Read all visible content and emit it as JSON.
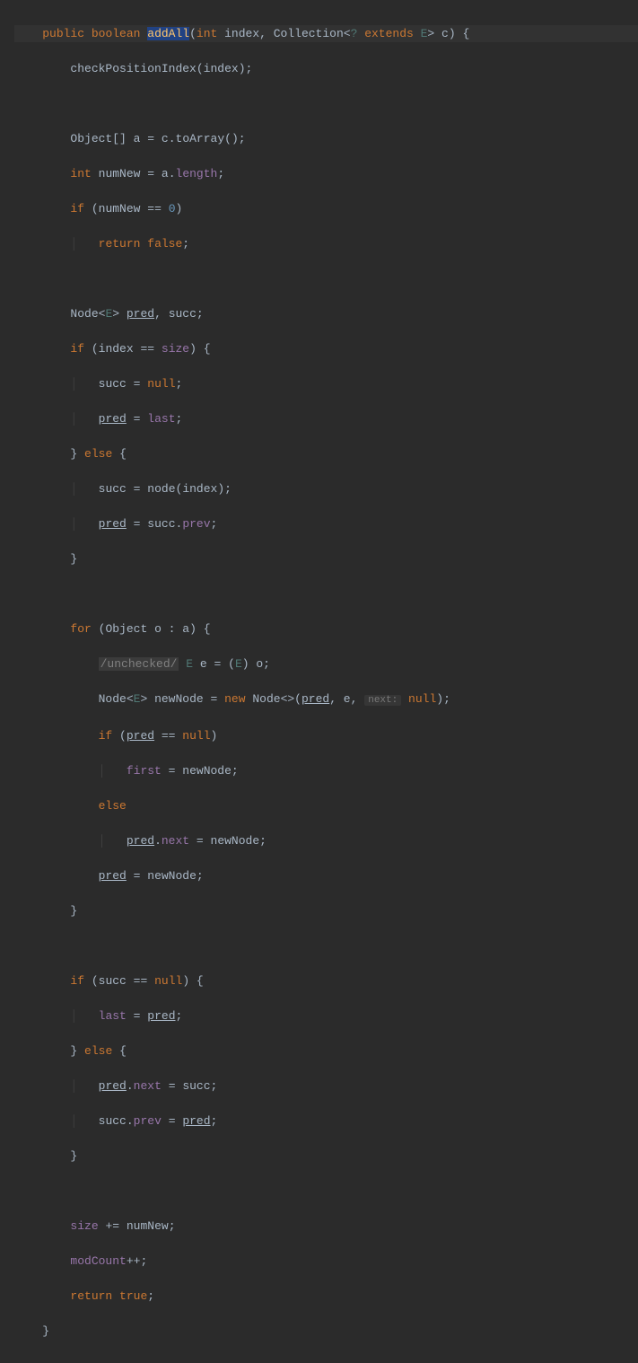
{
  "code": {
    "l1": {
      "public": "public",
      "boolean": "boolean",
      "method": "addAll",
      "int": "int",
      "index": "index",
      "coll": "Collection",
      "q": "?",
      "extends": "extends",
      "E": "E",
      "c": "c",
      "brace": "{"
    },
    "l2": {
      "call": "checkPositionIndex",
      "arg": "index"
    },
    "l3": {
      "obj": "Object",
      "arr": "[]",
      "a": "a",
      "eq": "=",
      "c": "c",
      "method": "toArray"
    },
    "l4": {
      "int": "int",
      "var": "numNew",
      "eq": "=",
      "a": "a",
      "field": "length"
    },
    "l5": {
      "if": "if",
      "var": "numNew",
      "eq": "==",
      "zero": "0"
    },
    "l6": {
      "return": "return",
      "false": "false"
    },
    "l7": {
      "node": "Node",
      "E": "E",
      "pred": "pred",
      "succ": "succ"
    },
    "l8": {
      "if": "if",
      "index": "index",
      "eq": "==",
      "size": "size",
      "brace": "{"
    },
    "l9": {
      "succ": "succ",
      "eq": "=",
      "null": "null"
    },
    "l10": {
      "pred": "pred",
      "eq": "=",
      "last": "last"
    },
    "l11": {
      "cbrace": "}",
      "else": "else",
      "obrace": "{"
    },
    "l12": {
      "succ": "succ",
      "eq": "=",
      "node": "node",
      "index": "index"
    },
    "l13": {
      "pred": "pred",
      "eq": "=",
      "succ": "succ",
      "prev": "prev"
    },
    "l14": {
      "brace": "}"
    },
    "l15": {
      "for": "for",
      "obj": "Object",
      "o": "o",
      "a": "a",
      "brace": "{"
    },
    "l16": {
      "comment": "/unchecked/",
      "E": "E",
      "e": "e",
      "eq": "=",
      "E2": "E",
      "o": "o"
    },
    "l17": {
      "node": "Node",
      "E": "E",
      "var": "newNode",
      "eq": "=",
      "new": "new",
      "node2": "Node",
      "pred": "pred",
      "e": "e",
      "hint": "next:",
      "null": "null"
    },
    "l18": {
      "if": "if",
      "pred": "pred",
      "eq": "==",
      "null": "null"
    },
    "l19": {
      "first": "first",
      "eq": "=",
      "newNode": "newNode"
    },
    "l20": {
      "else": "else"
    },
    "l21": {
      "pred": "pred",
      "next": "next",
      "eq": "=",
      "newNode": "newNode"
    },
    "l22": {
      "pred": "pred",
      "eq": "=",
      "newNode": "newNode"
    },
    "l23": {
      "brace": "}"
    },
    "l24": {
      "if": "if",
      "succ": "succ",
      "eq": "==",
      "null": "null",
      "brace": "{"
    },
    "l25": {
      "last": "last",
      "eq": "=",
      "pred": "pred"
    },
    "l26": {
      "cbrace": "}",
      "else": "else",
      "obrace": "{"
    },
    "l27": {
      "pred": "pred",
      "next": "next",
      "eq": "=",
      "succ": "succ"
    },
    "l28": {
      "succ": "succ",
      "prev": "prev",
      "eq": "=",
      "pred": "pred"
    },
    "l29": {
      "brace": "}"
    },
    "l30": {
      "size": "size",
      "op": "+=",
      "var": "numNew"
    },
    "l31": {
      "modCount": "modCount",
      "op": "++"
    },
    "l32": {
      "return": "return",
      "true": "true"
    },
    "l33": {
      "brace": "}"
    }
  }
}
